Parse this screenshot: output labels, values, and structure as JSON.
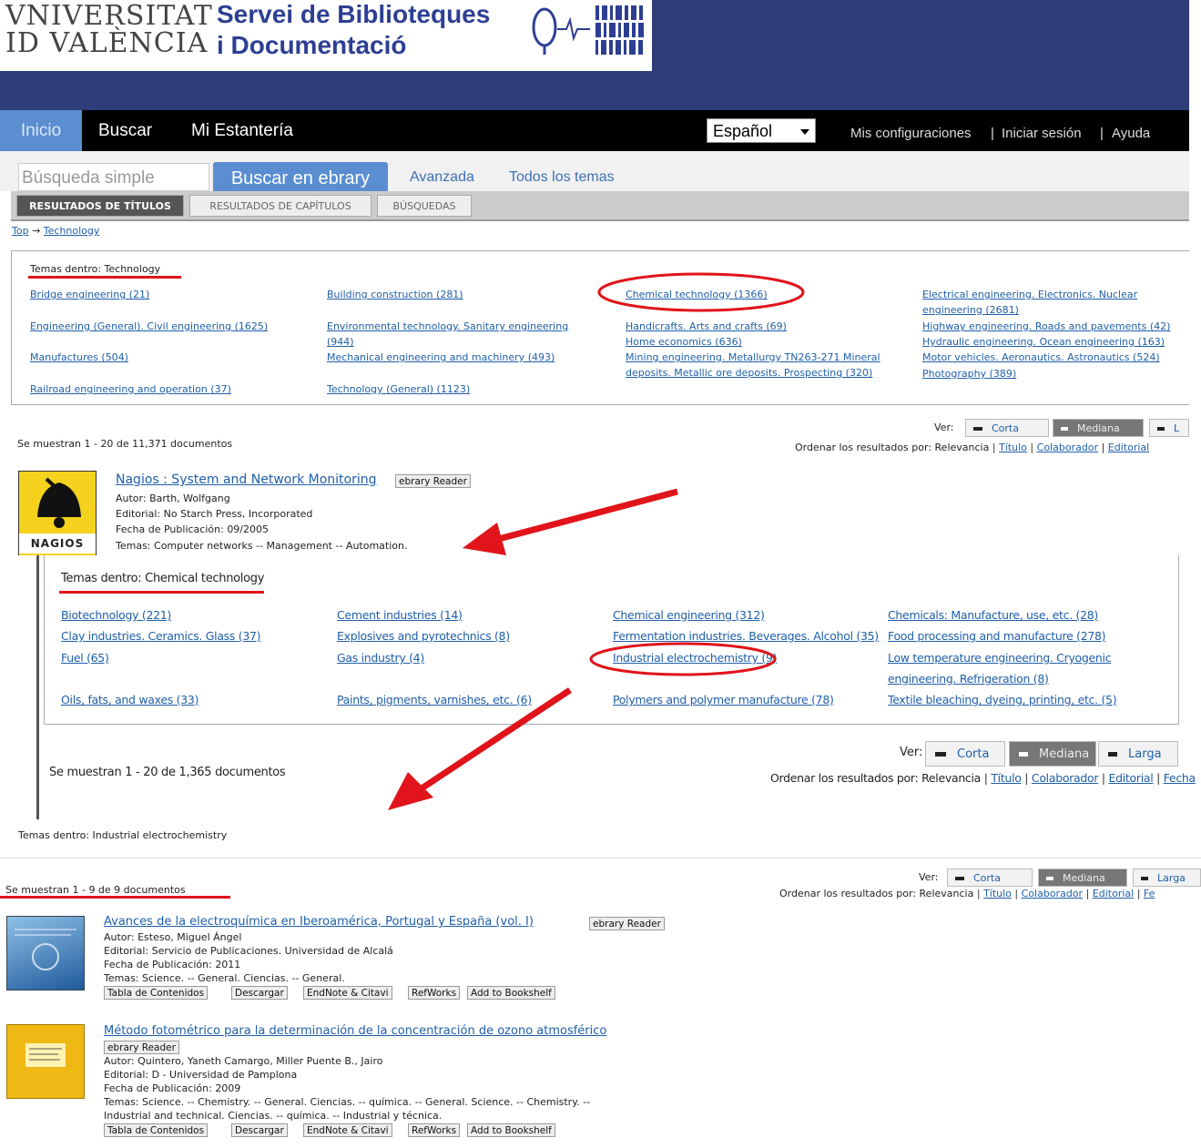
{
  "header": {
    "univ_line1": "VNIVERSITAT",
    "univ_line2": "ID VALÈNCIA",
    "service_line1": "Servei de Biblioteques",
    "service_line2": "i Documentació"
  },
  "nav": {
    "items": [
      "Inicio",
      "Buscar",
      "Mi Estantería"
    ],
    "language": "Español",
    "links": [
      "Mis configuraciones",
      "Iniciar sesión",
      "Ayuda"
    ],
    "separator": "|"
  },
  "search": {
    "simple_placeholder": "Búsqueda simple",
    "ebrary_button": "Buscar en ebrary",
    "advanced": "Avanzada",
    "all_topics": "Todos los temas"
  },
  "result_tabs": [
    "RESULTADOS DE TÍTULOS",
    "RESULTADOS DE CAPÍTULOS",
    "BÚSQUEDAS"
  ],
  "breadcrumb": {
    "top": "Top",
    "arrow": "→",
    "current": "Technology"
  },
  "panel1": {
    "heading": "Temas dentro: Technology",
    "topics": [
      [
        "Bridge engineering (21)",
        "Building construction (281)",
        "Chemical technology (1366)",
        "Electrical engineering. Electronics. Nuclear engineering (2681)"
      ],
      [
        "Engineering (General). Civil engineering (1625)",
        "Environmental technology. Sanitary engineering (944)",
        "Handicrafts. Arts and crafts (69)",
        "Highway engineering. Roads and pavements (42)"
      ],
      [
        "Manufactures (504)",
        "Mechanical engineering and machinery (493)",
        "Home economics (636)",
        "Hydraulic engineering. Ocean engineering (163)"
      ],
      [
        "Railroad engineering and operation (37)",
        "Technology (General) (1123)",
        "Mining engineering. Metallurgy TN263-271 Mineral deposits. Metallic ore deposits. Prospecting (320)",
        "Motor vehicles. Aeronautics. Astronautics (524)"
      ],
      [
        "",
        "",
        "",
        "Photography (389)"
      ]
    ],
    "ver_label": "Ver:",
    "views": [
      "Corta",
      "Mediana",
      "L"
    ],
    "sort_label": "Ordenar los resultados por:",
    "sort_options": [
      "Relevancia",
      "Título",
      "Colaborador",
      "Editorial"
    ],
    "count": "Se muestran 1 - 20 de 11,371 documentos",
    "book": {
      "cover_text": "NAGIOS",
      "title": "Nagios : System and Network Monitoring",
      "reader": "ebrary Reader",
      "author_label": "Autor:",
      "author": "Barth, Wolfgang",
      "publisher_label": "Editorial:",
      "publisher": "No Starch Press, Incorporated",
      "date_label": "Fecha de Publicación:",
      "date": "09/2005",
      "topics_label": "Temas:",
      "topics": "Computer networks -- Management -- Automation."
    }
  },
  "panel2": {
    "heading": "Temas dentro: Chemical technology",
    "topics": [
      "Biotechnology (221)",
      "Cement industries (14)",
      "Chemical engineering (312)",
      "Chemicals: Manufacture, use, etc. (28)",
      "Clay industries. Ceramics. Glass (37)",
      "Explosives and pyrotechnics (8)",
      "Fermentation industries. Beverages. Alcohol (35)",
      "Food processing and manufacture (278)",
      "Fuel (65)",
      "Gas industry (4)",
      "Industrial electrochemistry (9)",
      "Low temperature engineering. Cryogenic",
      "",
      "",
      "",
      "engineering. Refrigeration (8)",
      "Oils, fats, and waxes (33)",
      "Paints, pigments, varnishes, etc. (6)",
      "Polymers and polymer manufacture (78)",
      "Textile bleaching, dyeing, printing, etc. (5)"
    ],
    "ver_label": "Ver:",
    "views": [
      "Corta",
      "Mediana",
      "Larga"
    ],
    "sort_label": "Ordenar los resultados por:",
    "sort_options": [
      "Relevancia",
      "Título",
      "Colaborador",
      "Editorial",
      "Fecha"
    ],
    "count": "Se muestran 1 - 20 de 1,365 documentos"
  },
  "panel3": {
    "heading": "Temas dentro: Industrial electrochemistry",
    "ver_label": "Ver:",
    "views": [
      "Corta",
      "Mediana",
      "Larga"
    ],
    "sort_label": "Ordenar los resultados por:",
    "sort_options": [
      "Relevancia",
      "Título",
      "Colaborador",
      "Editorial",
      "Fe"
    ],
    "count": "Se muestran 1 - 9 de 9 documentos",
    "books": [
      {
        "title": "Avances de la electroquímica en Iberoamérica, Portugal y España (vol. I)",
        "reader": "ebrary Reader",
        "author_label": "Autor:",
        "author": "Esteso, Miguel Ángel",
        "publisher_label": "Editorial:",
        "publisher": "Servicio de Publicaciones. Universidad de Alcalá",
        "date_label": "Fecha de Publicación:",
        "date": "2011",
        "topics_label": "Temas:",
        "topics": "Science. -- General.   Ciencias. -- General.",
        "topics2": "",
        "actions": [
          "Tabla de Contenidos",
          "Descargar",
          "EndNote & Citavi",
          "RefWorks",
          "Add to Bookshelf"
        ]
      },
      {
        "title": "Método fotométrico para la determinación de la concentración de ozono atmosférico",
        "reader": "ebrary Reader",
        "author_label": "Autor:",
        "author": "Quintero, Yaneth   Camargo, Miller   Puente B., Jairo",
        "publisher_label": "Editorial:",
        "publisher": "D - Universidad de Pamplona",
        "date_label": "Fecha de Publicación:",
        "date": "2009",
        "topics_label": "Temas:",
        "topics": "Science. -- Chemistry. -- General.   Ciencias. -- química. -- General.   Science. -- Chemistry. --",
        "topics2": "Industrial and technical.   Ciencias. -- química. -- Industrial y técnica.",
        "actions": [
          "Tabla de Contenidos",
          "Descargar",
          "EndNote & Citavi",
          "RefWorks",
          "Add to Bookshelf"
        ]
      }
    ]
  },
  "colors": {
    "banner": "#2e3d7a",
    "nav": "#000000",
    "link": "#1f5fa8",
    "highlight": "#e0141a",
    "tab_active": "#5a8ed1"
  }
}
